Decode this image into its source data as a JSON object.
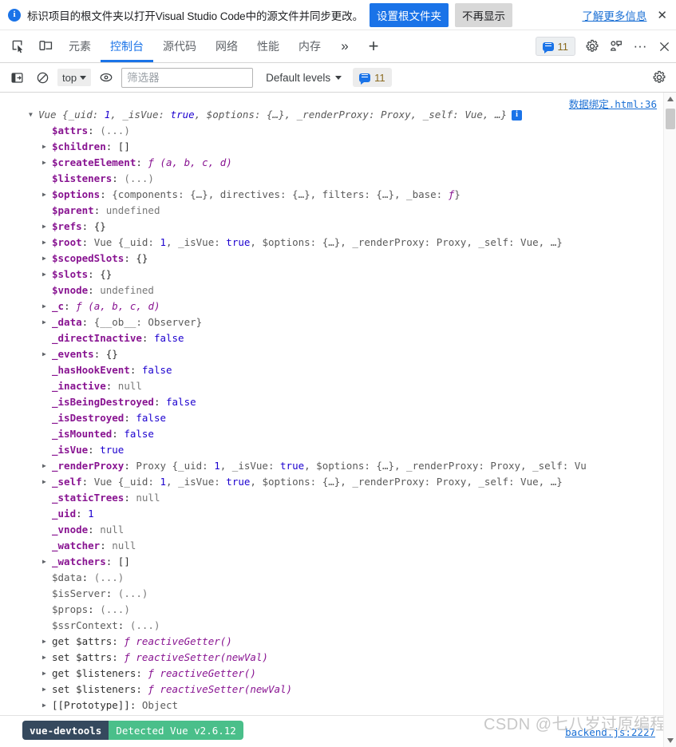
{
  "notification": {
    "icon": "info-circle-icon",
    "message": "标识项目的根文件夹以打开Visual Studio Code中的源文件并同步更改。",
    "primary_button": "设置根文件夹",
    "secondary_button": "不再显示",
    "link": "了解更多信息",
    "close": "✕"
  },
  "tabbar": {
    "inspect_icon": "inspect-element-icon",
    "device_icon": "device-toolbar-icon",
    "tabs": [
      {
        "label": "元素",
        "active": false
      },
      {
        "label": "控制台",
        "active": true
      },
      {
        "label": "源代码",
        "active": false
      },
      {
        "label": "网络",
        "active": false
      },
      {
        "label": "性能",
        "active": false
      },
      {
        "label": "内存",
        "active": false
      }
    ],
    "overflow": "»",
    "add_tab": "+",
    "issues_count": "11",
    "settings_icon": "gear-icon",
    "customize_icon": "devtools-customize-icon",
    "more_icon": "···",
    "close_icon": "✕"
  },
  "console_toolbar": {
    "sidebar_icon": "console-sidebar-icon",
    "clear_icon": "clear-console-icon",
    "context": "top",
    "eye_icon": "live-expression-icon",
    "filter_placeholder": "筛选器",
    "filter_value": "",
    "levels": "Default levels",
    "issues_count": "11",
    "settings_icon": "console-settings-icon"
  },
  "console": {
    "source_link": "数据绑定.html:36",
    "rows": [
      {
        "indent": 0,
        "arrow": "open",
        "segs": [
          {
            "t": "Vue ",
            "c": "k-preview k-italic"
          },
          {
            "t": "{_uid: ",
            "c": "k-preview k-italic"
          },
          {
            "t": "1",
            "c": "k-num k-italic"
          },
          {
            "t": ", _isVue: ",
            "c": "k-preview k-italic"
          },
          {
            "t": "true",
            "c": "k-bool k-italic"
          },
          {
            "t": ", $options: {…}, _renderProxy: Proxy, _self: Vue, …}",
            "c": "k-preview k-italic"
          }
        ],
        "info": true
      },
      {
        "indent": 1,
        "arrow": "none",
        "segs": [
          {
            "t": "$attrs",
            "c": "k-key"
          },
          {
            "t": ": ",
            "c": "k-punct"
          },
          {
            "t": "(...)",
            "c": "k-null"
          }
        ]
      },
      {
        "indent": 1,
        "arrow": "closed",
        "segs": [
          {
            "t": "$children",
            "c": "k-key"
          },
          {
            "t": ": ",
            "c": "k-punct"
          },
          {
            "t": "[]",
            "c": "k-obj"
          }
        ]
      },
      {
        "indent": 1,
        "arrow": "closed",
        "segs": [
          {
            "t": "$createElement",
            "c": "k-key"
          },
          {
            "t": ": ",
            "c": "k-punct"
          },
          {
            "t": "ƒ ",
            "c": "k-fnkw"
          },
          {
            "t": "(a, b, c, d)",
            "c": "k-fn"
          }
        ]
      },
      {
        "indent": 1,
        "arrow": "none",
        "segs": [
          {
            "t": "$listeners",
            "c": "k-key"
          },
          {
            "t": ": ",
            "c": "k-punct"
          },
          {
            "t": "(...)",
            "c": "k-null"
          }
        ]
      },
      {
        "indent": 1,
        "arrow": "closed",
        "segs": [
          {
            "t": "$options",
            "c": "k-key"
          },
          {
            "t": ": ",
            "c": "k-punct"
          },
          {
            "t": "{components: {…}, directives: {…}, filters: {…}, _base: ",
            "c": "k-preview"
          },
          {
            "t": "ƒ",
            "c": "k-fnkw"
          },
          {
            "t": "}",
            "c": "k-preview"
          }
        ]
      },
      {
        "indent": 1,
        "arrow": "none",
        "segs": [
          {
            "t": "$parent",
            "c": "k-key"
          },
          {
            "t": ": ",
            "c": "k-punct"
          },
          {
            "t": "undefined",
            "c": "k-undef"
          }
        ]
      },
      {
        "indent": 1,
        "arrow": "closed",
        "segs": [
          {
            "t": "$refs",
            "c": "k-key"
          },
          {
            "t": ": ",
            "c": "k-punct"
          },
          {
            "t": "{}",
            "c": "k-obj"
          }
        ]
      },
      {
        "indent": 1,
        "arrow": "closed",
        "segs": [
          {
            "t": "$root",
            "c": "k-key"
          },
          {
            "t": ": ",
            "c": "k-punct"
          },
          {
            "t": "Vue {_uid: ",
            "c": "k-preview"
          },
          {
            "t": "1",
            "c": "k-num"
          },
          {
            "t": ", _isVue: ",
            "c": "k-preview"
          },
          {
            "t": "true",
            "c": "k-bool"
          },
          {
            "t": ", $options: {…}, _renderProxy: Proxy, _self: Vue, …}",
            "c": "k-preview"
          }
        ]
      },
      {
        "indent": 1,
        "arrow": "closed",
        "segs": [
          {
            "t": "$scopedSlots",
            "c": "k-key"
          },
          {
            "t": ": ",
            "c": "k-punct"
          },
          {
            "t": "{}",
            "c": "k-obj"
          }
        ]
      },
      {
        "indent": 1,
        "arrow": "closed",
        "segs": [
          {
            "t": "$slots",
            "c": "k-key"
          },
          {
            "t": ": ",
            "c": "k-punct"
          },
          {
            "t": "{}",
            "c": "k-obj"
          }
        ]
      },
      {
        "indent": 1,
        "arrow": "none",
        "segs": [
          {
            "t": "$vnode",
            "c": "k-key"
          },
          {
            "t": ": ",
            "c": "k-punct"
          },
          {
            "t": "undefined",
            "c": "k-undef"
          }
        ]
      },
      {
        "indent": 1,
        "arrow": "closed",
        "segs": [
          {
            "t": "_c",
            "c": "k-key"
          },
          {
            "t": ": ",
            "c": "k-punct"
          },
          {
            "t": "ƒ ",
            "c": "k-fnkw"
          },
          {
            "t": "(a, b, c, d)",
            "c": "k-fn"
          }
        ]
      },
      {
        "indent": 1,
        "arrow": "closed",
        "segs": [
          {
            "t": "_data",
            "c": "k-key"
          },
          {
            "t": ": ",
            "c": "k-punct"
          },
          {
            "t": "{__ob__: Observer}",
            "c": "k-preview"
          }
        ]
      },
      {
        "indent": 1,
        "arrow": "none",
        "segs": [
          {
            "t": "_directInactive",
            "c": "k-key"
          },
          {
            "t": ": ",
            "c": "k-punct"
          },
          {
            "t": "false",
            "c": "k-bool"
          }
        ]
      },
      {
        "indent": 1,
        "arrow": "closed",
        "segs": [
          {
            "t": "_events",
            "c": "k-key"
          },
          {
            "t": ": ",
            "c": "k-punct"
          },
          {
            "t": "{}",
            "c": "k-obj"
          }
        ]
      },
      {
        "indent": 1,
        "arrow": "none",
        "segs": [
          {
            "t": "_hasHookEvent",
            "c": "k-key"
          },
          {
            "t": ": ",
            "c": "k-punct"
          },
          {
            "t": "false",
            "c": "k-bool"
          }
        ]
      },
      {
        "indent": 1,
        "arrow": "none",
        "segs": [
          {
            "t": "_inactive",
            "c": "k-key"
          },
          {
            "t": ": ",
            "c": "k-punct"
          },
          {
            "t": "null",
            "c": "k-null"
          }
        ]
      },
      {
        "indent": 1,
        "arrow": "none",
        "segs": [
          {
            "t": "_isBeingDestroyed",
            "c": "k-key"
          },
          {
            "t": ": ",
            "c": "k-punct"
          },
          {
            "t": "false",
            "c": "k-bool"
          }
        ]
      },
      {
        "indent": 1,
        "arrow": "none",
        "segs": [
          {
            "t": "_isDestroyed",
            "c": "k-key"
          },
          {
            "t": ": ",
            "c": "k-punct"
          },
          {
            "t": "false",
            "c": "k-bool"
          }
        ]
      },
      {
        "indent": 1,
        "arrow": "none",
        "segs": [
          {
            "t": "_isMounted",
            "c": "k-key"
          },
          {
            "t": ": ",
            "c": "k-punct"
          },
          {
            "t": "false",
            "c": "k-bool"
          }
        ]
      },
      {
        "indent": 1,
        "arrow": "none",
        "segs": [
          {
            "t": "_isVue",
            "c": "k-key"
          },
          {
            "t": ": ",
            "c": "k-punct"
          },
          {
            "t": "true",
            "c": "k-bool"
          }
        ]
      },
      {
        "indent": 1,
        "arrow": "closed",
        "segs": [
          {
            "t": "_renderProxy",
            "c": "k-key"
          },
          {
            "t": ": ",
            "c": "k-punct"
          },
          {
            "t": "Proxy {_uid: ",
            "c": "k-preview"
          },
          {
            "t": "1",
            "c": "k-num"
          },
          {
            "t": ", _isVue: ",
            "c": "k-preview"
          },
          {
            "t": "true",
            "c": "k-bool"
          },
          {
            "t": ", $options: {…}, _renderProxy: Proxy, _self: Vu",
            "c": "k-preview"
          }
        ]
      },
      {
        "indent": 1,
        "arrow": "closed",
        "segs": [
          {
            "t": "_self",
            "c": "k-key"
          },
          {
            "t": ": ",
            "c": "k-punct"
          },
          {
            "t": "Vue {_uid: ",
            "c": "k-preview"
          },
          {
            "t": "1",
            "c": "k-num"
          },
          {
            "t": ", _isVue: ",
            "c": "k-preview"
          },
          {
            "t": "true",
            "c": "k-bool"
          },
          {
            "t": ", $options: {…}, _renderProxy: Proxy, _self: Vue, …}",
            "c": "k-preview"
          }
        ]
      },
      {
        "indent": 1,
        "arrow": "none",
        "segs": [
          {
            "t": "_staticTrees",
            "c": "k-key"
          },
          {
            "t": ": ",
            "c": "k-punct"
          },
          {
            "t": "null",
            "c": "k-null"
          }
        ]
      },
      {
        "indent": 1,
        "arrow": "none",
        "segs": [
          {
            "t": "_uid",
            "c": "k-key"
          },
          {
            "t": ": ",
            "c": "k-punct"
          },
          {
            "t": "1",
            "c": "k-num"
          }
        ]
      },
      {
        "indent": 1,
        "arrow": "none",
        "segs": [
          {
            "t": "_vnode",
            "c": "k-key"
          },
          {
            "t": ": ",
            "c": "k-punct"
          },
          {
            "t": "null",
            "c": "k-null"
          }
        ]
      },
      {
        "indent": 1,
        "arrow": "none",
        "segs": [
          {
            "t": "_watcher",
            "c": "k-key"
          },
          {
            "t": ": ",
            "c": "k-punct"
          },
          {
            "t": "null",
            "c": "k-null"
          }
        ]
      },
      {
        "indent": 1,
        "arrow": "closed",
        "segs": [
          {
            "t": "_watchers",
            "c": "k-key"
          },
          {
            "t": ": ",
            "c": "k-punct"
          },
          {
            "t": "[]",
            "c": "k-obj"
          }
        ]
      },
      {
        "indent": 1,
        "arrow": "none",
        "segs": [
          {
            "t": "$data",
            "c": "k-key-dim"
          },
          {
            "t": ": ",
            "c": "k-punct"
          },
          {
            "t": "(...)",
            "c": "k-null"
          }
        ]
      },
      {
        "indent": 1,
        "arrow": "none",
        "segs": [
          {
            "t": "$isServer",
            "c": "k-key-dim"
          },
          {
            "t": ": ",
            "c": "k-punct"
          },
          {
            "t": "(...)",
            "c": "k-null"
          }
        ]
      },
      {
        "indent": 1,
        "arrow": "none",
        "segs": [
          {
            "t": "$props",
            "c": "k-key-dim"
          },
          {
            "t": ": ",
            "c": "k-punct"
          },
          {
            "t": "(...)",
            "c": "k-null"
          }
        ]
      },
      {
        "indent": 1,
        "arrow": "none",
        "segs": [
          {
            "t": "$ssrContext",
            "c": "k-key-dim"
          },
          {
            "t": ": ",
            "c": "k-punct"
          },
          {
            "t": "(...)",
            "c": "k-null"
          }
        ]
      },
      {
        "indent": 1,
        "arrow": "closed",
        "segs": [
          {
            "t": "get $attrs",
            "c": "k-getset"
          },
          {
            "t": ": ",
            "c": "k-punct"
          },
          {
            "t": "ƒ ",
            "c": "k-fnkw"
          },
          {
            "t": "reactiveGetter()",
            "c": "k-fn"
          }
        ]
      },
      {
        "indent": 1,
        "arrow": "closed",
        "segs": [
          {
            "t": "set $attrs",
            "c": "k-getset"
          },
          {
            "t": ": ",
            "c": "k-punct"
          },
          {
            "t": "ƒ ",
            "c": "k-fnkw"
          },
          {
            "t": "reactiveSetter(newVal)",
            "c": "k-fn"
          }
        ]
      },
      {
        "indent": 1,
        "arrow": "closed",
        "segs": [
          {
            "t": "get $listeners",
            "c": "k-getset"
          },
          {
            "t": ": ",
            "c": "k-punct"
          },
          {
            "t": "ƒ ",
            "c": "k-fnkw"
          },
          {
            "t": "reactiveGetter()",
            "c": "k-fn"
          }
        ]
      },
      {
        "indent": 1,
        "arrow": "closed",
        "segs": [
          {
            "t": "set $listeners",
            "c": "k-getset"
          },
          {
            "t": ": ",
            "c": "k-punct"
          },
          {
            "t": "ƒ ",
            "c": "k-fnkw"
          },
          {
            "t": "reactiveSetter(newVal)",
            "c": "k-fn"
          }
        ]
      },
      {
        "indent": 1,
        "arrow": "closed",
        "segs": [
          {
            "t": "[[Prototype]]",
            "c": "k-proto"
          },
          {
            "t": ": ",
            "c": "k-punct"
          },
          {
            "t": "Object",
            "c": "k-preview"
          }
        ]
      }
    ]
  },
  "bottom": {
    "devtools_badge_left": "vue-devtools",
    "devtools_badge_right": "Detected Vue v2.6.12",
    "source_link": "backend.js:2227",
    "watermark": "CSDN @七八岁过原编程"
  },
  "colors": {
    "accent": "#1a73e8",
    "vue_dark": "#35495e",
    "vue_green": "#4abf8a",
    "key_purple": "#881391",
    "number_blue": "#1c00cf"
  }
}
